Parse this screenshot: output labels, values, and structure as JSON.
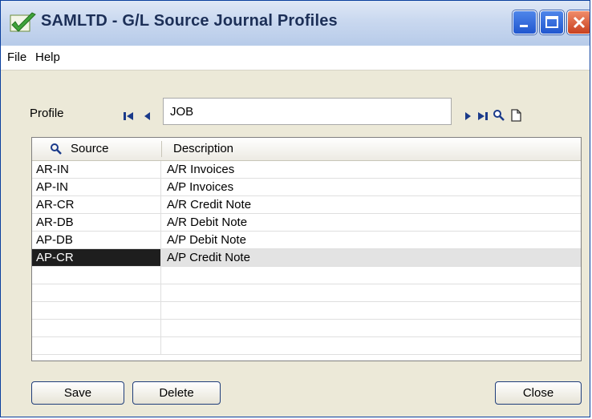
{
  "window": {
    "title": "SAMLTD - G/L Source Journal Profiles",
    "icon": "green-checkmark-icon",
    "controls": [
      "minimize-icon",
      "maximize-icon",
      "close-icon"
    ]
  },
  "menu": {
    "items": [
      "File",
      "Help"
    ]
  },
  "profile": {
    "label": "Profile",
    "value": "JOB",
    "nav_icons": [
      "first-record-icon",
      "previous-record-icon",
      "next-record-icon",
      "last-record-icon",
      "finder-icon",
      "new-document-icon"
    ]
  },
  "grid": {
    "header_icon": "finder-icon",
    "columns": [
      "Source",
      "Description"
    ],
    "rows": [
      {
        "source": "AR-IN",
        "description": "A/R Invoices"
      },
      {
        "source": "AP-IN",
        "description": "A/P Invoices"
      },
      {
        "source": "AR-CR",
        "description": "A/R Credit Note"
      },
      {
        "source": "AR-DB",
        "description": "A/R Debit Note"
      },
      {
        "source": "AP-DB",
        "description": "A/P Debit Note"
      },
      {
        "source": "AP-CR",
        "description": "A/P Credit Note"
      },
      {
        "source": "",
        "description": ""
      },
      {
        "source": "",
        "description": ""
      },
      {
        "source": "",
        "description": ""
      },
      {
        "source": "",
        "description": ""
      },
      {
        "source": "",
        "description": ""
      }
    ],
    "selected_row": 5
  },
  "buttons": {
    "save": "Save",
    "delete": "Delete",
    "close": "Close"
  },
  "colors": {
    "title_text": "#1c2f57",
    "nav_icon": "#1a3a8a",
    "window_bg": "#ece9d8"
  }
}
